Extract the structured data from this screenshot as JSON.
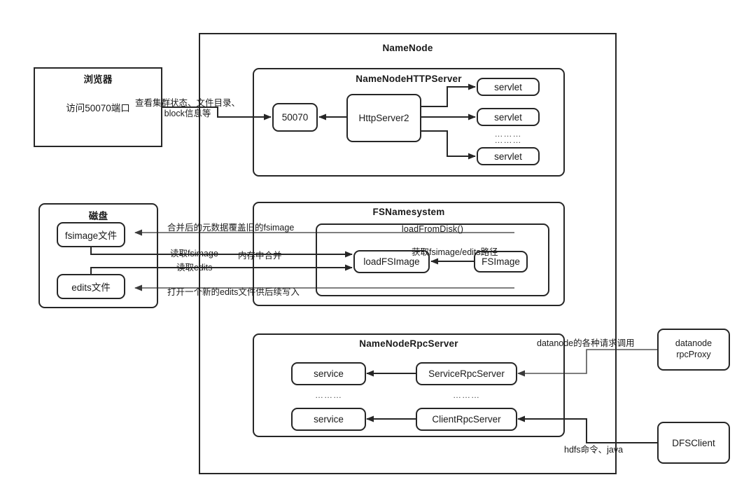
{
  "diagram": {
    "title_visible": false
  },
  "browser": {
    "title": "浏览器",
    "body": "访问50070端口"
  },
  "disk": {
    "title": "磁盘",
    "fsimage_file": "fsimage文件",
    "edits_file": "edits文件"
  },
  "namenode": {
    "title": "NameNode"
  },
  "http_server": {
    "title": "NameNodeHTTPServer",
    "port_box": "50070",
    "http_server2": "HttpServer2",
    "servlets": [
      "servlet",
      "servlet",
      "servlet"
    ],
    "ellipsis": "………"
  },
  "fsnamesystem": {
    "title": "FSNamesystem",
    "load_from_disk": "loadFromDisk()",
    "load_fsimage": "loadFSImage",
    "fsimage": "FSImage"
  },
  "rpc_server": {
    "title": "NameNodeRpcServer",
    "service_top": "service",
    "service_bottom": "service",
    "service_rpc_server": "ServiceRpcServer",
    "client_rpc_server": "ClientRpcServer",
    "ellipsis_left": "………",
    "ellipsis_right": "………"
  },
  "externals": {
    "datanode_rpc_proxy_line1": "datanode",
    "datanode_rpc_proxy_line2": "rpcProxy",
    "dfs_client": "DFSClient"
  },
  "edges": {
    "browser_to_port_line1": "查看集群状态、文件目录、",
    "browser_to_port_line2": "block信息等",
    "merged_overwrite_fsimage": "合并后的元数据覆盖旧的fsimage",
    "read_fsimage": "读取fsimage",
    "read_edits": "读取edits",
    "merge_in_memory": "内存中合并",
    "open_new_edits": "打开一个新的edits文件供后续写入",
    "get_fsimage_edits_path": "获取fsimage/edits路径",
    "datanode_requests": "datanode的各种请求调用",
    "hdfs_commands": "hdfs命令、java"
  },
  "colors": {
    "stroke": "#262626",
    "thin_stroke": "#555555",
    "text": "#1a1a1a",
    "background": "#ffffff"
  }
}
